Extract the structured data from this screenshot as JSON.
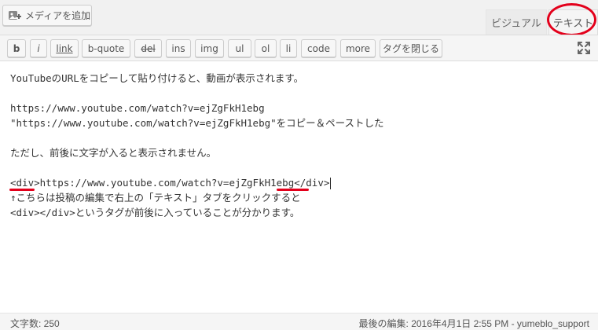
{
  "media_button": {
    "label": "メディアを追加",
    "icon": "media-add-icon"
  },
  "tabs": {
    "visual": "ビジュアル",
    "text": "テキスト"
  },
  "toolbar": {
    "buttons": [
      "b",
      "i",
      "link",
      "b-quote",
      "del",
      "ins",
      "img",
      "ul",
      "ol",
      "li",
      "code",
      "more",
      "タグを閉じる"
    ],
    "fullscreen_icon": "fullscreen-icon"
  },
  "editor": {
    "lines": [
      "YouTubeのURLをコピーして貼り付けると、動画が表示されます。",
      "",
      "https://www.youtube.com/watch?v=ejZgFkH1ebg",
      "\"https://www.youtube.com/watch?v=ejZgFkH1ebg\"をコピー＆ペーストした",
      "",
      "ただし、前後に文字が入ると表示されません。",
      "",
      "<div>https://www.youtube.com/watch?v=ejZgFkH1ebg</div>",
      "↑こちらは投稿の編集で右上の「テキスト」タブをクリックすると",
      "<div></div>というタグが前後に入っていることが分かります。"
    ]
  },
  "status": {
    "word_count": "文字数: 250",
    "last_edit": "最後の編集: 2016年4月1日 2:55 PM - yumeblo_support"
  },
  "colors": {
    "annotation": "#e3001b"
  }
}
